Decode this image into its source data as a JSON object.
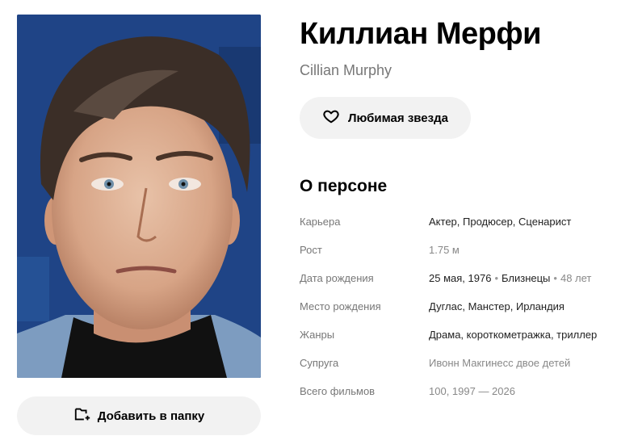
{
  "person": {
    "name_ru": "Киллиан Мерфи",
    "name_en": "Cillian Murphy"
  },
  "buttons": {
    "favorite_label": "Любимая звезда",
    "add_folder_label": "Добавить в папку"
  },
  "about": {
    "section_title": "О персоне",
    "rows": [
      {
        "key": "Карьера",
        "value": "Актер, Продюсер, Сценарист"
      },
      {
        "key": "Рост",
        "value": "1.75 м"
      },
      {
        "key": "Дата рождения",
        "date": "25 мая, 1976",
        "sign": "Близнецы",
        "age": "48 лет"
      },
      {
        "key": "Место рождения",
        "value": "Дуглас, Манстер, Ирландия"
      },
      {
        "key": "Жанры",
        "value": "Драма, короткометражка, триллер"
      },
      {
        "key": "Супруга",
        "value": "Ивонн Макгинесс  двое детей"
      },
      {
        "key": "Всего фильмов",
        "value": "100, 1997 — 2026"
      }
    ]
  },
  "icons": {
    "favorite": "heart-icon",
    "add_folder": "folder-plus-icon"
  }
}
